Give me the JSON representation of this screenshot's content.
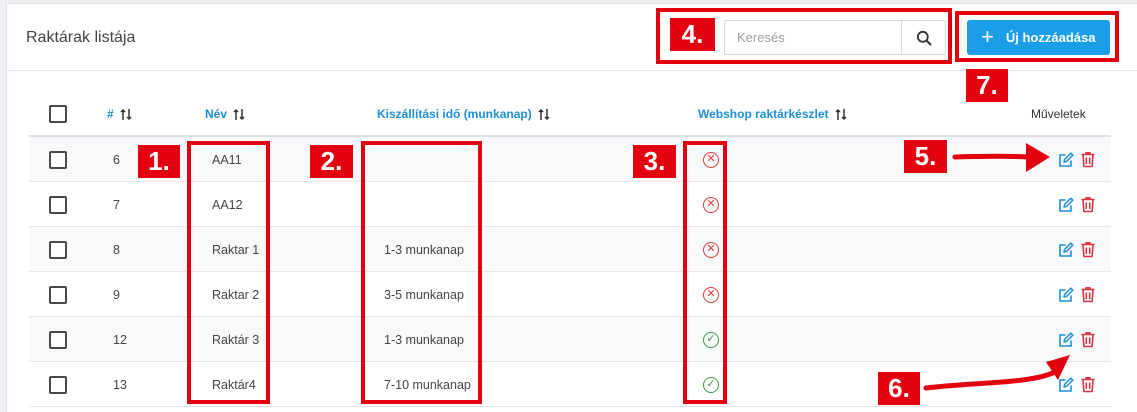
{
  "header": {
    "title": "Raktárak listája",
    "search_placeholder": "Keresés",
    "add_button_label": "Új hozzáadása"
  },
  "table": {
    "columns": {
      "id": "#",
      "name": "Név",
      "delivery": "Kiszállítási idő (munkanap)",
      "webshop": "Webshop raktárkészlet",
      "actions": "Műveletek"
    },
    "rows": [
      {
        "id": "6",
        "name": "AA11",
        "delivery": "",
        "webshop": false
      },
      {
        "id": "7",
        "name": "AA12",
        "delivery": "",
        "webshop": false
      },
      {
        "id": "8",
        "name": "Raktar 1",
        "delivery": "1-3 munkanap",
        "webshop": false
      },
      {
        "id": "9",
        "name": "Raktar 2",
        "delivery": "3-5 munkanap",
        "webshop": false
      },
      {
        "id": "12",
        "name": "Raktár 3",
        "delivery": "1-3 munkanap",
        "webshop": true
      },
      {
        "id": "13",
        "name": "Raktár4",
        "delivery": "7-10 munkanap",
        "webshop": true
      }
    ]
  },
  "annotations": [
    "1.",
    "2.",
    "3.",
    "4.",
    "5.",
    "6.",
    "7."
  ],
  "colors": {
    "accent": "#1a9ee8",
    "annotation": "#e3000f",
    "status_no": "#e03b3b",
    "status_yes": "#3a9a3a",
    "edit": "#1d8fd6",
    "delete": "#d9333f"
  },
  "icons": {
    "search": "search-icon",
    "add": "plus-icon",
    "sort": "sort-icon",
    "edit": "edit-icon",
    "delete": "trash-icon",
    "webshop_no": "x-circle-icon",
    "webshop_yes": "check-circle-icon"
  }
}
